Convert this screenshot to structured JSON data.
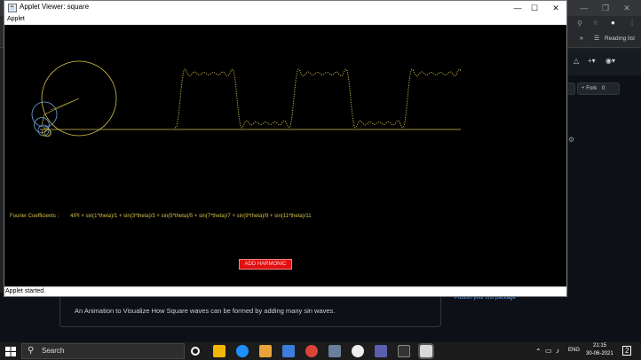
{
  "applet": {
    "title": "Applet Viewer: square",
    "menu_label": "Applet",
    "fourier_label": "Fourier Coefficients :",
    "fourier_formula": "4/PI × sin(1*theta)/1 + sin(3*theta)/3 + sin(5*theta)/5 + sin(7*theta)/7 + sin(9*theta)/9 + sin(11*theta)/11",
    "add_harmonic_label": "ADD HARMONIC",
    "status": "Applet started.",
    "harmonics": [
      1,
      3,
      5,
      7,
      9,
      11
    ],
    "colors": {
      "canvas": "#000000",
      "wave": "#d4c24a",
      "circle_small": "#6fa8dc",
      "button": "#e01010"
    },
    "controls": {
      "minimize": "—",
      "maximize": "☐",
      "close": "✕"
    }
  },
  "browser": {
    "reading_list": "Reading list",
    "fork_label": "Fork",
    "fork_count": "0",
    "description": "An Animation to Visualize How Square waves can be formed by adding many sin waves.",
    "publish_text": "Publish your first package"
  },
  "taskbar": {
    "search_placeholder": "Search",
    "language": "ENG",
    "time": "21:15",
    "date": "30-06-2021",
    "notification_count": "2"
  }
}
